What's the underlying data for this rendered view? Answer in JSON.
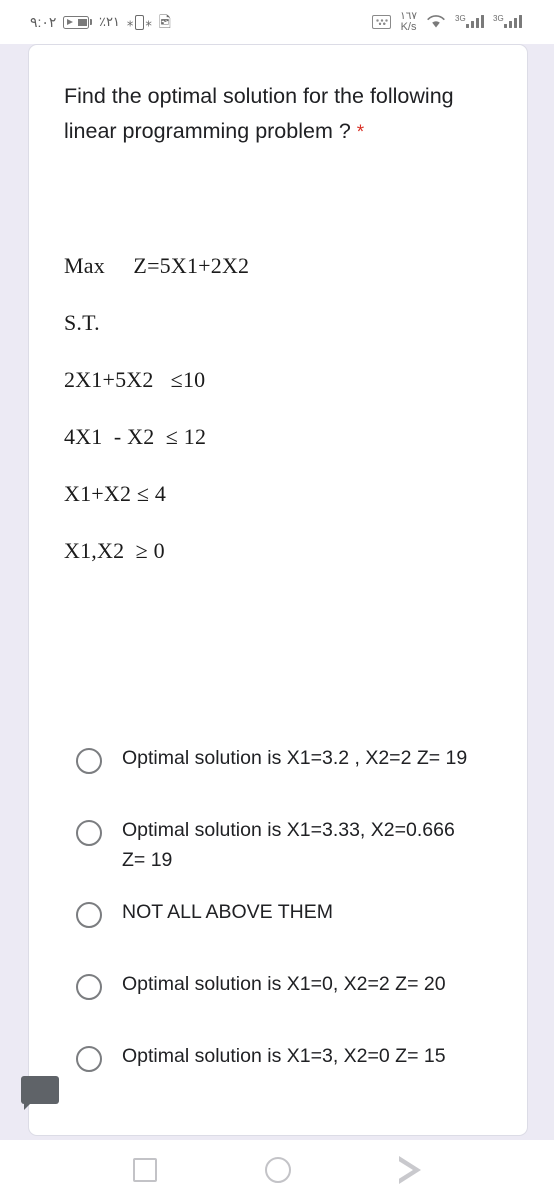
{
  "statusbar": {
    "time": "٩:٠٢",
    "battery_percent": "٪٢١",
    "battery_icon": "battery-charging-icon",
    "vibrate_icon": "vibrate-icon",
    "bluetooth_icon": "bluetooth-icon",
    "bluetooth_glyph": "",
    "keyboard_icon": "keyboard-icon",
    "data_rate_value": "١٦٧",
    "data_rate_unit": "K/s",
    "wifi_icon": "wifi-icon",
    "signal_1_label": "3G",
    "signal_2_label": "3G"
  },
  "question": {
    "text": "Find the optimal solution for the following linear programming problem ?",
    "required_marker": "*"
  },
  "problem_image": {
    "lines": [
      "Max     Z=5X1+2X2",
      "S.T.",
      "2X1+5X2   ≤10",
      "4X1  - X2  ≤ 12",
      "X1+X2 ≤ 4",
      "X1,X2  ≥ 0"
    ]
  },
  "options": [
    {
      "label": "Optimal solution is X1=3.2 , X2=2 Z= 19",
      "selected": false
    },
    {
      "label": "Optimal solution is X1=3.33, X2=0.666 Z= 19",
      "selected": false
    },
    {
      "label": "NOT ALL ABOVE THEM",
      "selected": false
    },
    {
      "label": "Optimal solution is X1=0, X2=2 Z= 20",
      "selected": false
    },
    {
      "label": "Optimal solution is X1=3, X2=0 Z= 15",
      "selected": false
    }
  ],
  "feedback_badge": {
    "icon": "feedback-exclamation-icon"
  },
  "navbar": {
    "recents_icon": "recents-square-icon",
    "home_icon": "home-circle-icon",
    "back_icon": "back-triangle-icon"
  },
  "colors": {
    "page_background": "#eceaf4",
    "card_background": "#ffffff",
    "required_red": "#d93025",
    "text_primary": "#202124",
    "radio_border": "#7b7d80",
    "badge_grey": "#5f6368"
  }
}
